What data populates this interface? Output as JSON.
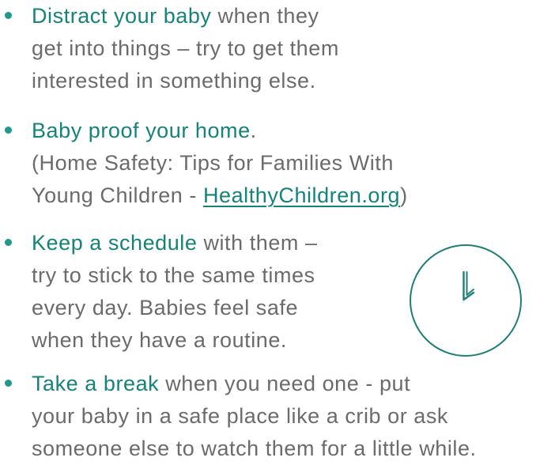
{
  "tips": [
    {
      "lead": "Distract your baby",
      "rest_first": " when they",
      "lines": [
        "get into things – try to get them",
        "interested in something else."
      ]
    },
    {
      "lead": "Baby proof your home",
      "rest_first": ".",
      "line2": "(Home Safety: Tips for Families With",
      "line3_prefix": "Young Children - ",
      "link": "HealthyChildren.org",
      "line3_suffix": ")"
    },
    {
      "lead": "Keep a schedule",
      "rest_first": " with them –",
      "lines": [
        "try to stick to the same times",
        "every day. Babies feel safe",
        "when they have a routine."
      ]
    },
    {
      "lead": "Take a break",
      "rest_first": " when you need one - put",
      "lines": [
        "your baby in a safe place like a crib or ask",
        "someone else to watch them for a little while."
      ]
    }
  ],
  "icons": {
    "clock": "clock-icon"
  },
  "colors": {
    "accent": "#15837a",
    "bullet": "#1f9a8f",
    "text": "#6b6b6b",
    "icon_stroke": "#1f7f78"
  }
}
